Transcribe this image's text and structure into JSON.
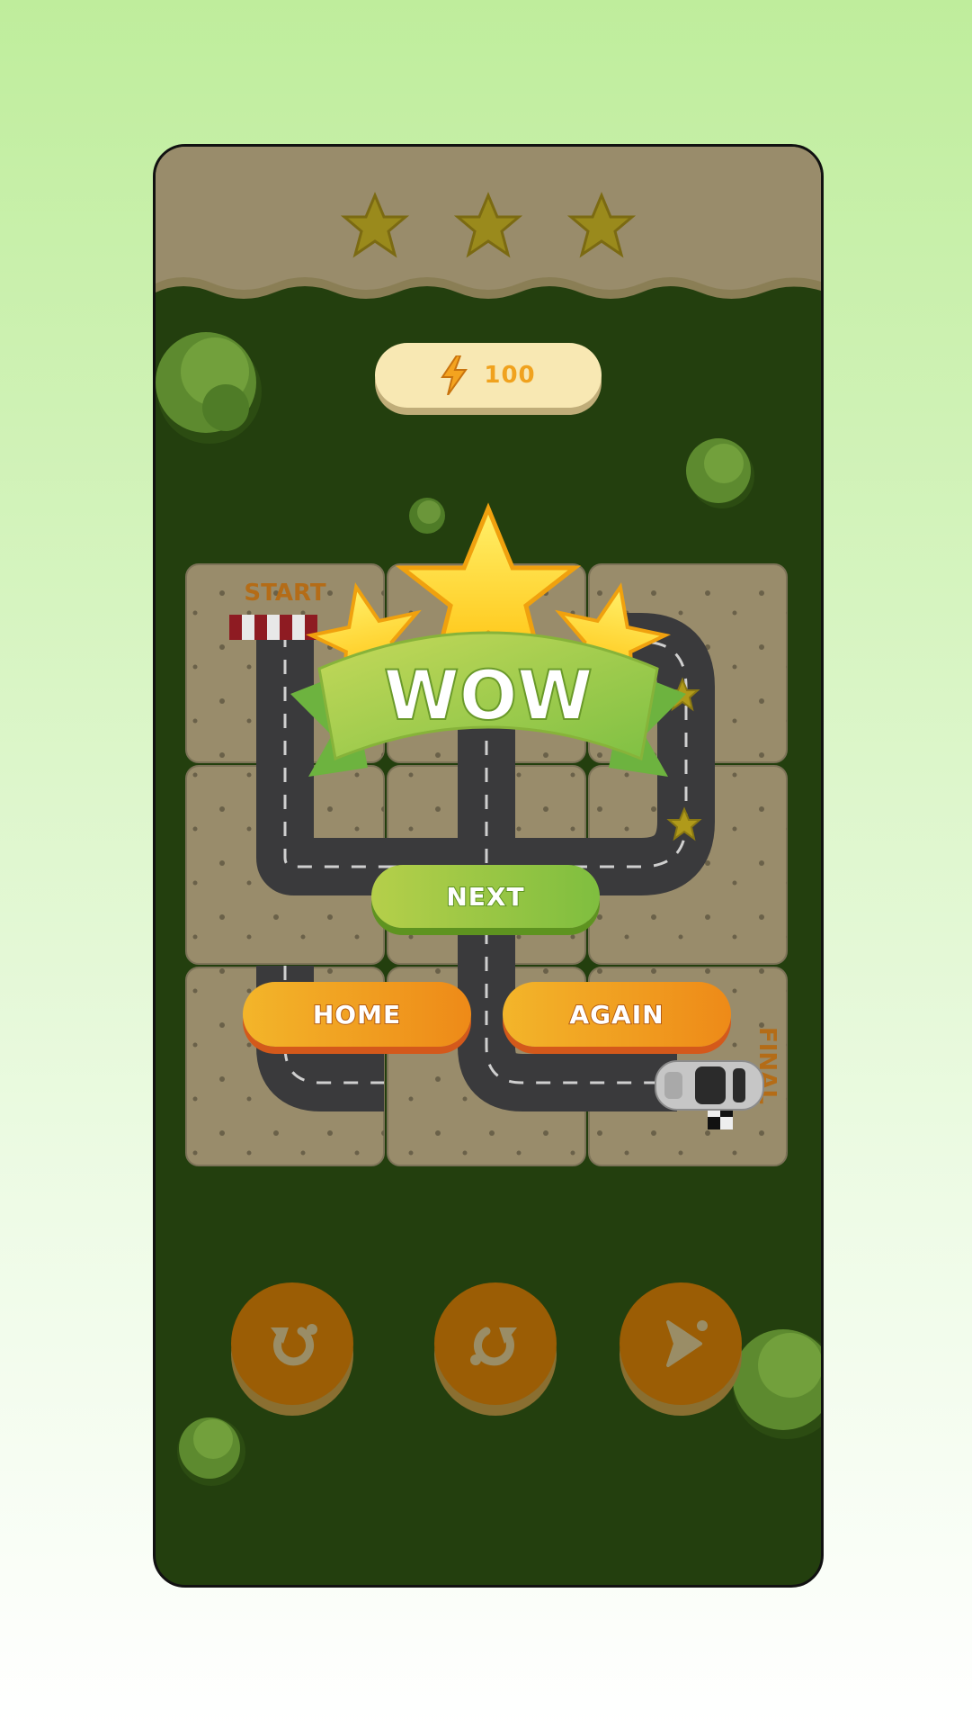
{
  "header": {
    "stars_earned": 3,
    "stars_total": 3
  },
  "coins": {
    "value": "100",
    "icon": "lightning-icon"
  },
  "board": {
    "start_label": "START",
    "final_label": "FINAL"
  },
  "result": {
    "banner_text": "WOW",
    "stars": 3
  },
  "buttons": {
    "next": "NEXT",
    "home": "HOME",
    "again": "AGAIN"
  },
  "controls": {
    "items": [
      "undo-icon",
      "redo-icon",
      "play-icon"
    ]
  },
  "colors": {
    "grass": "#233f0e",
    "dirt": "#998c6b",
    "road": "#3a3a3c",
    "star": "#ffd200",
    "banner": "#a6cc4a",
    "orange": "#f0961c"
  }
}
